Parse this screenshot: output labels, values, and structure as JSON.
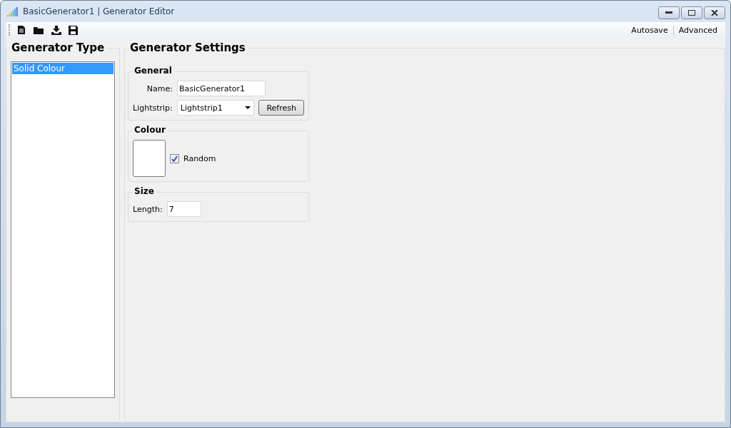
{
  "window": {
    "title": "BasicGenerator1 | Generator Editor"
  },
  "toolbar": {
    "right_items": [
      "Autosave",
      "Advanced"
    ]
  },
  "generator_type": {
    "title": "Generator Type",
    "items": [
      {
        "label": "Solid Colour",
        "selected": true
      }
    ]
  },
  "settings": {
    "title": "Generator Settings",
    "general": {
      "title": "General",
      "name_label": "Name:",
      "name_value": "BasicGenerator1",
      "lightstrip_label": "Lightstrip:",
      "lightstrip_value": "Lightstrip1",
      "refresh_button": "Refresh"
    },
    "colour": {
      "title": "Colour",
      "random_label": "Random",
      "random_checked": true
    },
    "size": {
      "title": "Size",
      "length_label": "Length:",
      "length_value": "7"
    }
  }
}
